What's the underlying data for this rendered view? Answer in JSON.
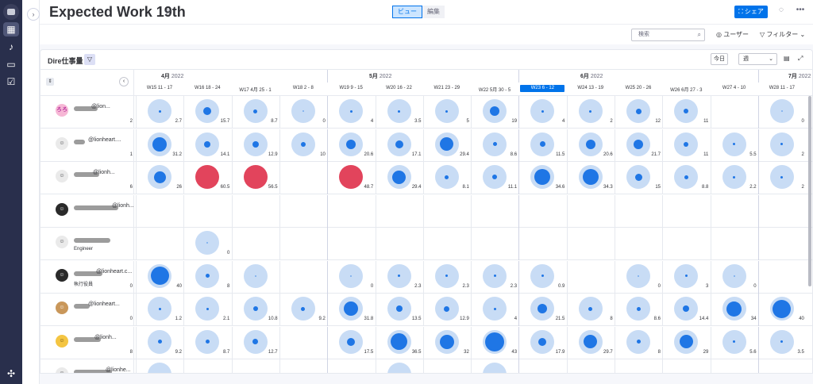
{
  "app": {
    "title": "Expected Work 19th",
    "view_tabs": [
      "ビュー",
      "編集"
    ],
    "share_label": "シェア"
  },
  "toolbar": {
    "search_placeholder": "検索",
    "users_label": "ユーザー",
    "filter_label": "フィルター"
  },
  "panel": {
    "title": "Dire仕事量",
    "today_label": "今日",
    "period_value": "週"
  },
  "months": [
    {
      "label": "4月",
      "year": "2022"
    },
    {
      "label": "5月",
      "year": "2022"
    },
    {
      "label": "6月",
      "year": "2022"
    },
    {
      "label": "7月",
      "year": "2022"
    }
  ],
  "weeks": [
    {
      "label": "W15  11 - 17",
      "current": false
    },
    {
      "label": "W16  18 - 24",
      "current": false
    },
    {
      "label": "W17  4月 25 - 1",
      "current": false
    },
    {
      "label": "W18  2 - 8",
      "current": false
    },
    {
      "label": "W19  9 - 15",
      "current": false
    },
    {
      "label": "W20  16 - 22",
      "current": false
    },
    {
      "label": "W21  23 - 29",
      "current": false
    },
    {
      "label": "W22  5月 30 - 5",
      "current": false
    },
    {
      "label": "W23  6 - 12",
      "current": true
    },
    {
      "label": "W24  13 - 19",
      "current": false
    },
    {
      "label": "W25  20 - 26",
      "current": false
    },
    {
      "label": "W26  6月 27 - 3",
      "current": false
    },
    {
      "label": "W27  4 - 10",
      "current": false
    },
    {
      "label": "W28  11 - 17",
      "current": false
    }
  ],
  "people": [
    {
      "email": "@lion...",
      "subtitle": "",
      "avatar": "ろろ",
      "prev_num": "2",
      "cells": [
        [
          1,
          "2.7"
        ],
        [
          1,
          "15.7"
        ],
        [
          1,
          "8.7"
        ],
        [
          1,
          "0"
        ],
        [
          1,
          "4"
        ],
        [
          1,
          "3.5"
        ],
        [
          1,
          "5"
        ],
        [
          1,
          "19"
        ],
        [
          1,
          "4"
        ],
        [
          1,
          "2"
        ],
        [
          1,
          "12"
        ],
        [
          1,
          "11"
        ],
        [
          0,
          ""
        ],
        [
          1,
          "0"
        ]
      ],
      "loads": [
        0.05,
        0.4,
        0.2,
        0,
        0.08,
        0.07,
        0.1,
        0.5,
        0.08,
        0.04,
        0.3,
        0.25,
        0,
        0
      ]
    },
    {
      "email": "@lionheart....",
      "subtitle": "",
      "avatar": "",
      "prev_num": "1",
      "cells": [
        [
          1,
          "31.2"
        ],
        [
          1,
          "14.1"
        ],
        [
          1,
          "12.9"
        ],
        [
          1,
          "10"
        ],
        [
          1,
          "20.6"
        ],
        [
          1,
          "17.1"
        ],
        [
          1,
          "29.4"
        ],
        [
          1,
          "8.6"
        ],
        [
          1,
          "11.5"
        ],
        [
          1,
          "20.6"
        ],
        [
          1,
          "21.7"
        ],
        [
          1,
          "11"
        ],
        [
          1,
          "5.5"
        ],
        [
          1,
          "2"
        ]
      ],
      "loads": [
        0.75,
        0.35,
        0.32,
        0.25,
        0.5,
        0.42,
        0.7,
        0.2,
        0.28,
        0.5,
        0.52,
        0.27,
        0.13,
        0.05
      ]
    },
    {
      "email": "@lionh...",
      "subtitle": "",
      "avatar": "",
      "prev_num": "6",
      "cells": [
        [
          1,
          "26"
        ],
        [
          2,
          "60.5"
        ],
        [
          2,
          "56.5"
        ],
        [
          0,
          ""
        ],
        [
          2,
          "48.7"
        ],
        [
          1,
          "29.4"
        ],
        [
          1,
          "8.1"
        ],
        [
          1,
          "11.1"
        ],
        [
          1,
          "34.6"
        ],
        [
          1,
          "34.3"
        ],
        [
          1,
          "15"
        ],
        [
          1,
          "8.8"
        ],
        [
          1,
          "2.2"
        ],
        [
          1,
          "2"
        ]
      ],
      "loads": [
        0.62,
        1,
        1,
        0,
        1,
        0.7,
        0.2,
        0.27,
        0.83,
        0.82,
        0.36,
        0.21,
        0.05,
        0.05
      ]
    },
    {
      "email": "@lionh...",
      "subtitle": "",
      "avatar": "",
      "prev_num": "",
      "cells": [
        [
          0,
          ""
        ],
        [
          0,
          ""
        ],
        [
          0,
          ""
        ],
        [
          0,
          ""
        ],
        [
          0,
          ""
        ],
        [
          0,
          ""
        ],
        [
          0,
          ""
        ],
        [
          0,
          ""
        ],
        [
          0,
          ""
        ],
        [
          0,
          ""
        ],
        [
          0,
          ""
        ],
        [
          0,
          ""
        ],
        [
          0,
          ""
        ],
        [
          0,
          ""
        ]
      ],
      "loads": [
        0,
        0,
        0,
        0,
        0,
        0,
        0,
        0,
        0,
        0,
        0,
        0,
        0,
        0
      ]
    },
    {
      "email": "",
      "subtitle": "Engineer",
      "avatar": "",
      "prev_num": "",
      "cells": [
        [
          0,
          ""
        ],
        [
          1,
          "0"
        ],
        [
          0,
          ""
        ],
        [
          0,
          ""
        ],
        [
          0,
          ""
        ],
        [
          0,
          ""
        ],
        [
          0,
          ""
        ],
        [
          0,
          ""
        ],
        [
          0,
          ""
        ],
        [
          0,
          ""
        ],
        [
          0,
          ""
        ],
        [
          0,
          ""
        ],
        [
          0,
          ""
        ],
        [
          0,
          ""
        ]
      ],
      "loads": [
        0,
        0,
        0,
        0,
        0,
        0,
        0,
        0,
        0,
        0,
        0,
        0,
        0,
        0
      ]
    },
    {
      "email": "@lionheart.c...",
      "subtitle": "執行役員",
      "avatar": "",
      "prev_num": "0",
      "cells": [
        [
          1,
          "40"
        ],
        [
          1,
          "8"
        ],
        [
          1,
          ""
        ],
        [
          0,
          ""
        ],
        [
          1,
          "0"
        ],
        [
          1,
          "2.3"
        ],
        [
          1,
          "2.3"
        ],
        [
          1,
          "2.3"
        ],
        [
          1,
          "0.9"
        ],
        [
          0,
          ""
        ],
        [
          1,
          "0"
        ],
        [
          1,
          "3"
        ],
        [
          1,
          "0"
        ],
        [
          0,
          ""
        ]
      ],
      "loads": [
        0.95,
        0.2,
        0,
        0,
        0,
        0.05,
        0.05,
        0.05,
        0.02,
        0,
        0,
        0.07,
        0,
        0
      ]
    },
    {
      "email": "@lionheart...",
      "subtitle": "",
      "avatar": "",
      "prev_num": "0",
      "cells": [
        [
          1,
          "1.2"
        ],
        [
          1,
          "2.1"
        ],
        [
          1,
          "10.8"
        ],
        [
          1,
          "9.2"
        ],
        [
          1,
          "31.8"
        ],
        [
          1,
          "13.5"
        ],
        [
          1,
          "12.9"
        ],
        [
          1,
          "4"
        ],
        [
          1,
          "21.5"
        ],
        [
          1,
          "8"
        ],
        [
          1,
          "8.6"
        ],
        [
          1,
          "14.4"
        ],
        [
          1,
          "34"
        ],
        [
          1,
          "40"
        ]
      ],
      "loads": [
        0.03,
        0.05,
        0.26,
        0.22,
        0.76,
        0.32,
        0.31,
        0.1,
        0.51,
        0.19,
        0.2,
        0.34,
        0.81,
        0.95
      ]
    },
    {
      "email": "@lionh...",
      "subtitle": "",
      "avatar": "",
      "prev_num": "8",
      "cells": [
        [
          1,
          "9.2"
        ],
        [
          1,
          "8.7"
        ],
        [
          1,
          "12.7"
        ],
        [
          0,
          ""
        ],
        [
          1,
          "17.5"
        ],
        [
          1,
          "36.5"
        ],
        [
          1,
          "32"
        ],
        [
          1,
          "43"
        ],
        [
          1,
          "17.9"
        ],
        [
          1,
          "29.7"
        ],
        [
          1,
          "8"
        ],
        [
          1,
          "29"
        ],
        [
          1,
          "5.6"
        ],
        [
          1,
          "3.5"
        ]
      ],
      "loads": [
        0.22,
        0.21,
        0.3,
        0,
        0.42,
        0.87,
        0.76,
        1,
        0.43,
        0.71,
        0.19,
        0.69,
        0.13,
        0.08
      ]
    },
    {
      "email": "@lionhe...",
      "subtitle": "",
      "avatar": "",
      "prev_num": "",
      "cells": [
        [
          1,
          ""
        ],
        [
          0,
          ""
        ],
        [
          0,
          ""
        ],
        [
          0,
          ""
        ],
        [
          0,
          ""
        ],
        [
          1,
          ""
        ],
        [
          0,
          ""
        ],
        [
          1,
          ""
        ],
        [
          0,
          ""
        ],
        [
          0,
          ""
        ],
        [
          0,
          ""
        ],
        [
          0,
          ""
        ],
        [
          0,
          ""
        ],
        [
          0,
          ""
        ]
      ],
      "loads": [
        0,
        0,
        0,
        0,
        0,
        0,
        0,
        0,
        0,
        0,
        0,
        0,
        0,
        0
      ]
    }
  ],
  "colors": {
    "accent": "#0073ea",
    "bubble_bg": "#c8dcf5",
    "bubble_fill": "#1f76e5",
    "overload": "#e2445c"
  }
}
